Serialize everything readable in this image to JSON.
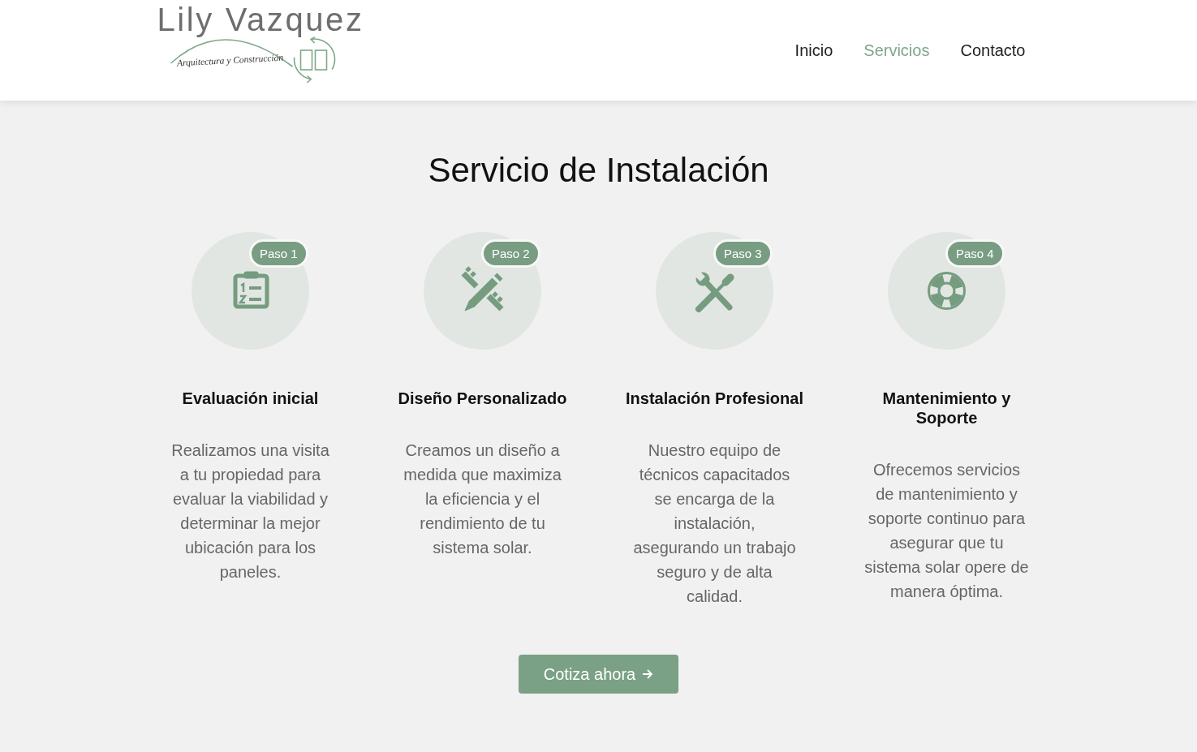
{
  "header": {
    "logo": {
      "title": "Lily Vazquez",
      "tagline": "Arquitectura y Construcción"
    },
    "nav": [
      {
        "label": "Inicio",
        "selected": false
      },
      {
        "label": "Servicios",
        "selected": true
      },
      {
        "label": "Contacto",
        "selected": false
      }
    ]
  },
  "section": {
    "title": "Servicio de Instalación",
    "steps": [
      {
        "badge": "Paso 1",
        "title": "Evaluación inicial",
        "text": "Realizamos una visita a tu propiedad para evaluar la viabilidad y determinar la mejor ubicación para los paneles."
      },
      {
        "badge": "Paso 2",
        "title": "Diseño Personalizado",
        "text": "Creamos un diseño a medida que maximiza la eficiencia y el rendimiento de tu sistema solar."
      },
      {
        "badge": "Paso 3",
        "title": "Instalación Profesional",
        "text": "Nuestro equipo de técnicos capacitados se encarga de la instalación, asegurando un trabajo seguro y de alta calidad."
      },
      {
        "badge": "Paso 4",
        "title": "Mantenimiento y Soporte",
        "text": "Ofrecemos servicios de mantenimiento y soporte continuo para asegurar que tu sistema solar opere de manera óptima."
      }
    ],
    "button": {
      "label": "Cotiza ahora"
    }
  }
}
